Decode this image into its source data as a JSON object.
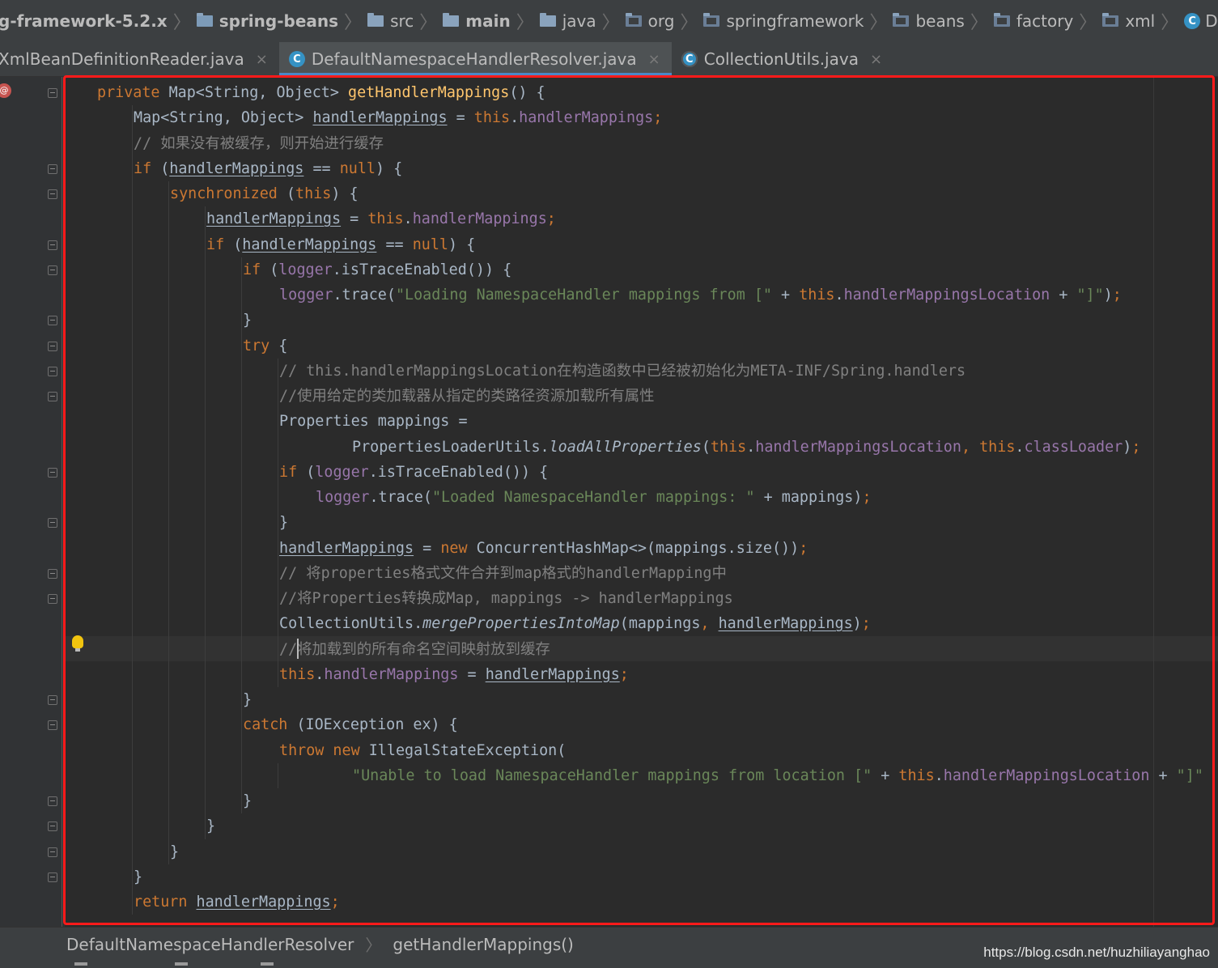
{
  "breadcrumb": {
    "items": [
      {
        "label": "g-framework-5.2.x",
        "icon": "none",
        "bold": true
      },
      {
        "label": "spring-beans",
        "icon": "module-folder-icon",
        "bold": true
      },
      {
        "label": "src",
        "icon": "folder-icon",
        "bold": false
      },
      {
        "label": "main",
        "icon": "source-folder-icon",
        "bold": true
      },
      {
        "label": "java",
        "icon": "source-root-icon",
        "bold": false
      },
      {
        "label": "org",
        "icon": "package-icon",
        "bold": false
      },
      {
        "label": "springframework",
        "icon": "package-icon",
        "bold": false
      },
      {
        "label": "beans",
        "icon": "package-icon",
        "bold": false
      },
      {
        "label": "factory",
        "icon": "package-icon",
        "bold": false
      },
      {
        "label": "xml",
        "icon": "package-icon",
        "bold": false
      },
      {
        "label": "DefaultNamespaceHandlerRe",
        "icon": "class-icon",
        "bold": false
      }
    ]
  },
  "tabs": [
    {
      "label": "XmlBeanDefinitionReader.java",
      "active": false,
      "close": "×"
    },
    {
      "label": "DefaultNamespaceHandlerResolver.java",
      "active": true,
      "close": "×"
    },
    {
      "label": "CollectionUtils.java",
      "active": false,
      "close": "×"
    }
  ],
  "code_lines": [
    {
      "indent": 0,
      "tokens": [
        [
          "kw",
          "private "
        ],
        [
          "",
          "Map<String, Object> "
        ],
        [
          "fn",
          "getHandlerMappings"
        ],
        [
          "",
          "() {"
        ]
      ]
    },
    {
      "indent": 1,
      "tokens": [
        [
          "",
          "Map<String, Object> "
        ],
        [
          "ul",
          "handlerMappings"
        ],
        [
          "",
          " = "
        ],
        [
          "kw",
          "this"
        ],
        [
          "",
          "."
        ],
        [
          "fld",
          "handlerMappings"
        ],
        [
          "kw",
          ";"
        ]
      ]
    },
    {
      "indent": 1,
      "tokens": [
        [
          "cmt",
          "// 如果没有被缓存，则开始进行缓存"
        ]
      ]
    },
    {
      "indent": 1,
      "tokens": [
        [
          "kw",
          "if "
        ],
        [
          "",
          "("
        ],
        [
          "ul",
          "handlerMappings"
        ],
        [
          "",
          " == "
        ],
        [
          "kw",
          "null"
        ],
        [
          "",
          ") {"
        ]
      ]
    },
    {
      "indent": 2,
      "tokens": [
        [
          "kw",
          "synchronized "
        ],
        [
          "",
          "("
        ],
        [
          "kw",
          "this"
        ],
        [
          "",
          ") {"
        ]
      ]
    },
    {
      "indent": 3,
      "tokens": [
        [
          "ul",
          "handlerMappings"
        ],
        [
          "",
          " = "
        ],
        [
          "kw",
          "this"
        ],
        [
          "",
          "."
        ],
        [
          "fld",
          "handlerMappings"
        ],
        [
          "kw",
          ";"
        ]
      ]
    },
    {
      "indent": 3,
      "tokens": [
        [
          "kw",
          "if "
        ],
        [
          "",
          "("
        ],
        [
          "ul",
          "handlerMappings"
        ],
        [
          "",
          " == "
        ],
        [
          "kw",
          "null"
        ],
        [
          "",
          ") {"
        ]
      ]
    },
    {
      "indent": 4,
      "tokens": [
        [
          "kw",
          "if "
        ],
        [
          "",
          "("
        ],
        [
          "fld",
          "logger"
        ],
        [
          "",
          ".isTraceEnabled()) {"
        ]
      ]
    },
    {
      "indent": 5,
      "tokens": [
        [
          "fld",
          "logger"
        ],
        [
          "",
          ".trace("
        ],
        [
          "str",
          "\"Loading NamespaceHandler mappings from [\""
        ],
        [
          "",
          " + "
        ],
        [
          "kw",
          "this"
        ],
        [
          "",
          "."
        ],
        [
          "fld",
          "handlerMappingsLocation"
        ],
        [
          "",
          " + "
        ],
        [
          "str",
          "\"]\""
        ],
        [
          "",
          ")"
        ],
        [
          "kw",
          ";"
        ]
      ]
    },
    {
      "indent": 4,
      "tokens": [
        [
          "",
          "}"
        ]
      ]
    },
    {
      "indent": 4,
      "tokens": [
        [
          "kw",
          "try "
        ],
        [
          "",
          "{"
        ]
      ]
    },
    {
      "indent": 5,
      "tokens": [
        [
          "cmt",
          "// this.handlerMappingsLocation在构造函数中已经被初始化为META-INF/Spring.handlers"
        ]
      ]
    },
    {
      "indent": 5,
      "tokens": [
        [
          "cmt",
          "//使用给定的类加载器从指定的类路径资源加载所有属性"
        ]
      ]
    },
    {
      "indent": 5,
      "tokens": [
        [
          "",
          "Properties mappings ="
        ]
      ]
    },
    {
      "indent": 7,
      "tokens": [
        [
          "",
          "PropertiesLoaderUtils."
        ],
        [
          "it",
          "loadAllProperties"
        ],
        [
          "",
          "("
        ],
        [
          "kw",
          "this"
        ],
        [
          "",
          "."
        ],
        [
          "fld",
          "handlerMappingsLocation"
        ],
        [
          "kw",
          ", "
        ],
        [
          "kw",
          "this"
        ],
        [
          "",
          "."
        ],
        [
          "fld",
          "classLoader"
        ],
        [
          "",
          ")"
        ],
        [
          "kw",
          ";"
        ]
      ]
    },
    {
      "indent": 5,
      "tokens": [
        [
          "kw",
          "if "
        ],
        [
          "",
          "("
        ],
        [
          "fld",
          "logger"
        ],
        [
          "",
          ".isTraceEnabled()) {"
        ]
      ]
    },
    {
      "indent": 6,
      "tokens": [
        [
          "fld",
          "logger"
        ],
        [
          "",
          ".trace("
        ],
        [
          "str",
          "\"Loaded NamespaceHandler mappings: \""
        ],
        [
          "",
          " + mappings)"
        ],
        [
          "kw",
          ";"
        ]
      ]
    },
    {
      "indent": 5,
      "tokens": [
        [
          "",
          "}"
        ]
      ]
    },
    {
      "indent": 5,
      "tokens": [
        [
          "ul",
          "handlerMappings"
        ],
        [
          "",
          " = "
        ],
        [
          "kw",
          "new "
        ],
        [
          "",
          "ConcurrentHashMap<>(mappings.size())"
        ],
        [
          "kw",
          ";"
        ]
      ]
    },
    {
      "indent": 5,
      "tokens": [
        [
          "cmt",
          "// 将properties格式文件合并到map格式的handlerMapping中"
        ]
      ]
    },
    {
      "indent": 5,
      "tokens": [
        [
          "cmt",
          "//将Properties转换成Map, mappings -> handlerMappings"
        ]
      ]
    },
    {
      "indent": 5,
      "tokens": [
        [
          "",
          "CollectionUtils."
        ],
        [
          "it",
          "mergePropertiesIntoMap"
        ],
        [
          "",
          "(mappings"
        ],
        [
          "kw",
          ", "
        ],
        [
          "ul",
          "handlerMappings"
        ],
        [
          "",
          ")"
        ],
        [
          "kw",
          ";"
        ]
      ]
    },
    {
      "indent": 5,
      "tokens": [
        [
          "cmt",
          "//将加载到的所有命名空间映射放到缓存"
        ]
      ]
    },
    {
      "indent": 5,
      "tokens": [
        [
          "kw",
          "this"
        ],
        [
          "",
          "."
        ],
        [
          "fld",
          "handlerMappings"
        ],
        [
          "",
          " = "
        ],
        [
          "ul",
          "handlerMappings"
        ],
        [
          "kw",
          ";"
        ]
      ]
    },
    {
      "indent": 4,
      "tokens": [
        [
          "",
          "}"
        ]
      ]
    },
    {
      "indent": 4,
      "tokens": [
        [
          "kw",
          "catch "
        ],
        [
          "",
          "(IOException ex) {"
        ]
      ]
    },
    {
      "indent": 5,
      "tokens": [
        [
          "kw",
          "throw new "
        ],
        [
          "",
          "IllegalStateException("
        ]
      ]
    },
    {
      "indent": 7,
      "tokens": [
        [
          "str",
          "\"Unable to load NamespaceHandler mappings from location [\""
        ],
        [
          "",
          " + "
        ],
        [
          "kw",
          "this"
        ],
        [
          "",
          "."
        ],
        [
          "fld",
          "handlerMappingsLocation"
        ],
        [
          "",
          " + "
        ],
        [
          "str",
          "\"]\""
        ]
      ]
    },
    {
      "indent": 4,
      "tokens": [
        [
          "",
          "}"
        ]
      ]
    },
    {
      "indent": 3,
      "tokens": [
        [
          "",
          "}"
        ]
      ]
    },
    {
      "indent": 2,
      "tokens": [
        [
          "",
          "}"
        ]
      ]
    },
    {
      "indent": 1,
      "tokens": [
        [
          "",
          "}"
        ]
      ]
    },
    {
      "indent": 1,
      "tokens": [
        [
          "kw",
          "return "
        ],
        [
          "ul",
          "handlerMappings"
        ],
        [
          "kw",
          ";"
        ]
      ]
    }
  ],
  "code_breadcrumb": {
    "class": "DefaultNamespaceHandlerResolver",
    "method": "getHandlerMappings()",
    "separator": "〉"
  },
  "watermark": "https://blog.csdn.net/huzhiliayanghao",
  "colors": {
    "keyword": "#cc7832",
    "string": "#6a8759",
    "field": "#9876aa",
    "method": "#ffc66d",
    "comment": "#808080",
    "highlight_box": "#ff1a1a",
    "active_tab_indicator": "#4a88c7"
  }
}
